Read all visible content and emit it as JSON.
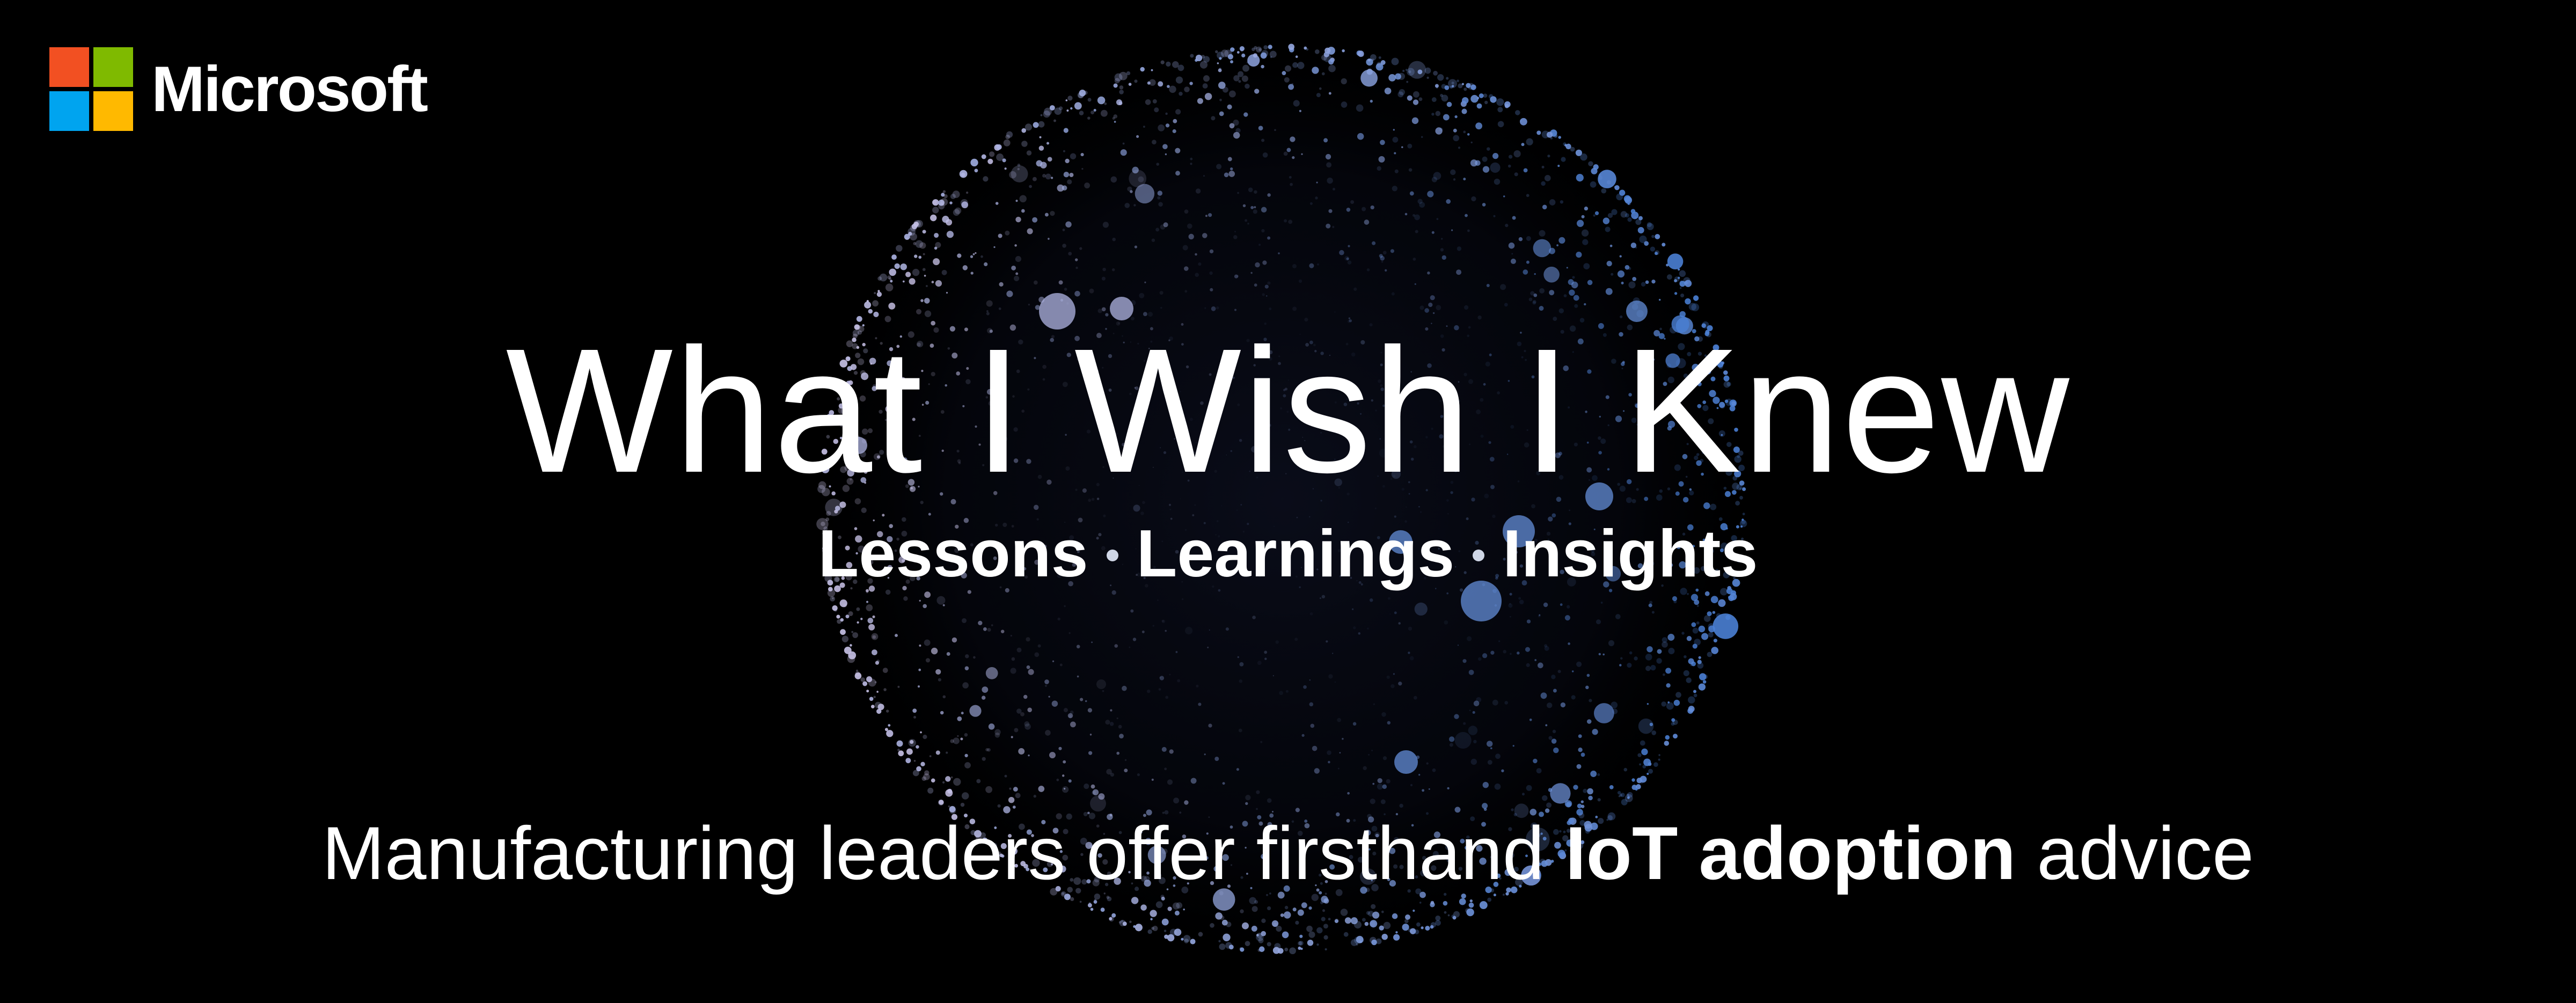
{
  "brand": {
    "name": "Microsoft",
    "colors": {
      "red": "#f25022",
      "green": "#7fba00",
      "blue": "#00a4ef",
      "yellow": "#ffb900"
    }
  },
  "headline": "What I Wish I Knew",
  "subline": {
    "items": [
      "Lessons",
      "Learnings",
      "Insights"
    ]
  },
  "tagline": {
    "prefix": "Manufacturing leaders offer firsthand ",
    "emphasis": "IoT adoption",
    "suffix": " advice"
  },
  "theme": {
    "background": "#000000",
    "text": "#ffffff",
    "globe_light": "#c9c3e8",
    "globe_blue": "#4a7fd4"
  }
}
